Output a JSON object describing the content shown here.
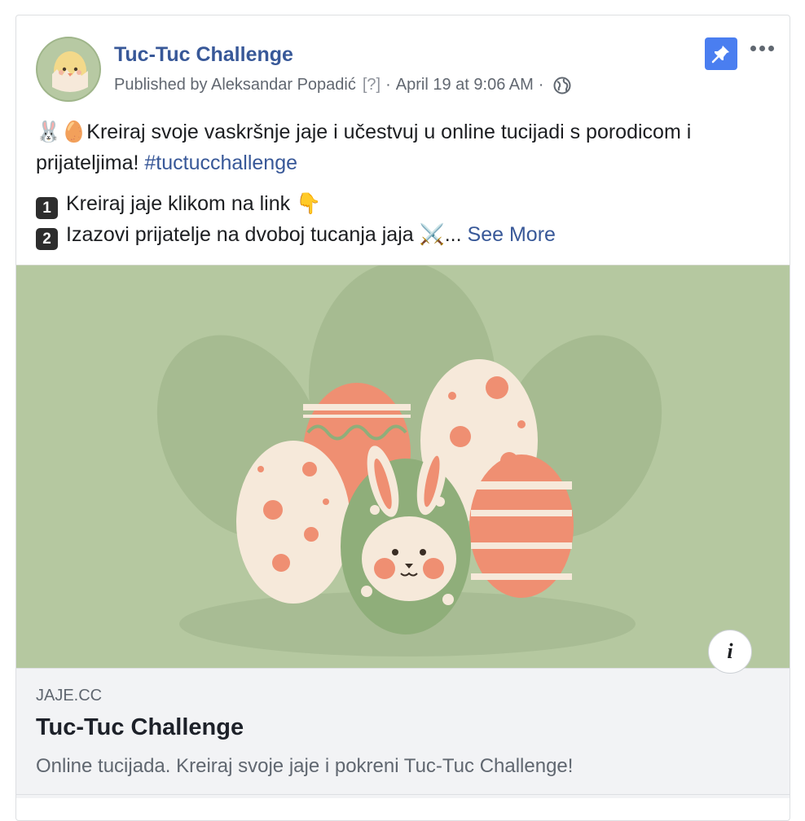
{
  "post": {
    "page_name": "Tuc-Tuc Challenge",
    "published_by": "Published by Aleksandar Popadić",
    "help_marker": "[?]",
    "separator": "·",
    "timestamp": "April 19 at 9:06 AM",
    "privacy_icon": "globe-icon",
    "pin_icon": "pin-icon",
    "more_icon": "more-dots-icon",
    "text": {
      "line1_emoji": "🐰🥚",
      "line1": "Kreiraj svoje vaskršnje jaje i učestvuj u online tucijadi s porodicom i prijateljima! ",
      "hashtag": "#tuctucchallenge",
      "step1_number": "1",
      "step1": "Kreiraj jaje klikom na link ",
      "step1_emoji": "👇",
      "step2_number": "2",
      "step2": "Izazovi prijatelje na dvoboj tucanja jaja ",
      "step2_emoji": "⚔️",
      "ellipsis": "... ",
      "see_more": "See More"
    }
  },
  "link_preview": {
    "domain": "JAJE.CC",
    "title": "Tuc-Tuc Challenge",
    "description": "Online tucijada. Kreiraj svoje jaje i pokreni Tuc-Tuc Challenge!",
    "info_label": "i"
  },
  "colors": {
    "link_blue": "#385898",
    "image_bg": "#b5c8a0",
    "pin_bg": "#4a7ef0",
    "egg_peach": "#ef8f72",
    "egg_cream": "#f6e9da",
    "egg_green": "#8fae7a"
  }
}
